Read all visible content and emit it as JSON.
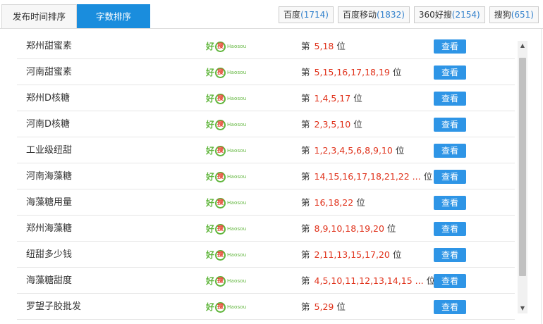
{
  "tabs": [
    {
      "label": "发布时间排序",
      "active": false
    },
    {
      "label": "字数排序",
      "active": true
    }
  ],
  "engines": [
    {
      "name": "百度",
      "count": "(1714)"
    },
    {
      "name": "百度移动",
      "count": "(1832)"
    },
    {
      "name": "360好搜",
      "count": "(2154)"
    },
    {
      "name": "搜狗",
      "count": "(651)"
    }
  ],
  "logo": {
    "hao": "好",
    "sou": "搜",
    "latin": "Haosou"
  },
  "rank_prefix": "第",
  "rank_suffix": "位",
  "view_label": "查看",
  "rows": [
    {
      "keyword": "郑州甜蜜素",
      "ranks": "5,18"
    },
    {
      "keyword": "河南甜蜜素",
      "ranks": "5,15,16,17,18,19"
    },
    {
      "keyword": "郑州D核糖",
      "ranks": "1,4,5,17"
    },
    {
      "keyword": "河南D核糖",
      "ranks": "2,3,5,10"
    },
    {
      "keyword": "工业级纽甜",
      "ranks": "1,2,3,4,5,6,8,9,10"
    },
    {
      "keyword": "河南海藻糖",
      "ranks": "14,15,16,17,18,21,22 ..."
    },
    {
      "keyword": "海藻糖用量",
      "ranks": "16,18,22"
    },
    {
      "keyword": "郑州海藻糖",
      "ranks": "8,9,10,18,19,20"
    },
    {
      "keyword": "纽甜多少钱",
      "ranks": "2,11,13,15,17,20"
    },
    {
      "keyword": "海藻糖甜度",
      "ranks": "4,5,10,11,12,13,14,15 ..."
    },
    {
      "keyword": "罗望子胶批发",
      "ranks": "5,29"
    }
  ]
}
